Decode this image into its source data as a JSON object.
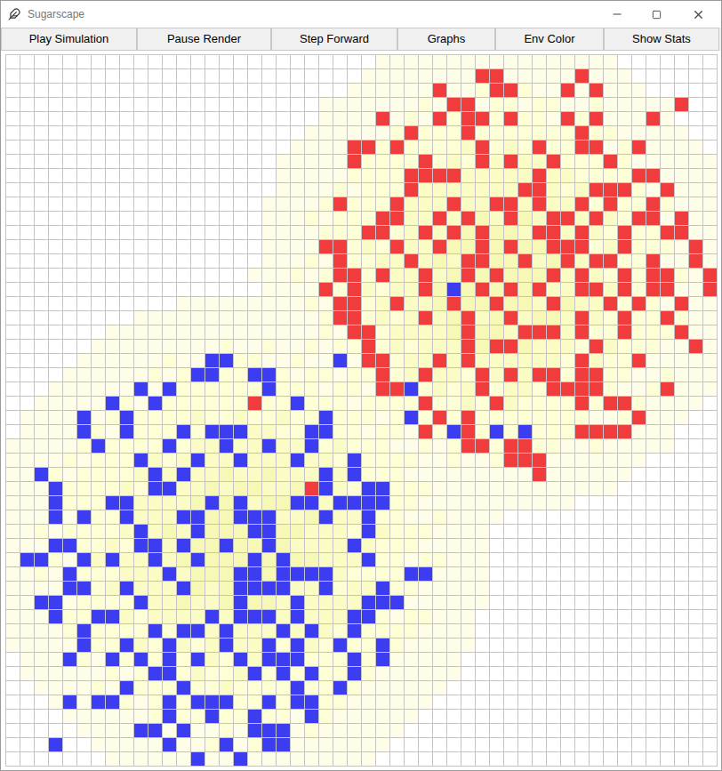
{
  "window": {
    "title": "Sugarscape"
  },
  "toolbar": [
    {
      "label": "Play Simulation"
    },
    {
      "label": "Pause Render"
    },
    {
      "label": "Step Forward"
    },
    {
      "label": "Graphs"
    },
    {
      "label": "Env Color"
    },
    {
      "label": "Show Stats"
    }
  ],
  "grid": {
    "rows": 50,
    "cols": 50,
    "sugar_peaks": [
      {
        "row": 15,
        "col": 34,
        "radius": 17,
        "max_level": 4
      },
      {
        "row": 34,
        "col": 16,
        "radius": 17.5,
        "max_level": 4
      }
    ],
    "tribes": [
      {
        "name": "red",
        "color": "#f03c3c",
        "cells": [
          [
            1,
            [
              33,
              34,
              40
            ]
          ],
          [
            2,
            [
              30,
              34,
              35,
              39,
              41
            ]
          ],
          [
            3,
            [
              31,
              32,
              47
            ]
          ],
          [
            4,
            [
              26,
              30,
              32,
              33,
              35,
              39,
              41,
              45
            ]
          ],
          [
            5,
            [
              28,
              32,
              40
            ]
          ],
          [
            6,
            [
              24,
              25,
              27,
              33,
              37,
              40,
              41,
              44
            ]
          ],
          [
            7,
            [
              24,
              29,
              33,
              35,
              38,
              42
            ]
          ],
          [
            8,
            [
              28,
              29,
              30,
              31,
              37,
              44,
              45
            ]
          ],
          [
            9,
            [
              28,
              36,
              37,
              41,
              42,
              43,
              46
            ]
          ],
          [
            10,
            [
              23,
              27,
              31,
              34,
              35,
              37,
              40,
              42,
              45
            ]
          ],
          [
            11,
            [
              26,
              27,
              30,
              32,
              35,
              38,
              39,
              41,
              44,
              45,
              47
            ]
          ],
          [
            12,
            [
              25,
              26,
              29,
              31,
              33,
              37,
              38,
              40,
              43,
              46,
              47
            ]
          ],
          [
            13,
            [
              22,
              23,
              27,
              30,
              33,
              35,
              38,
              39,
              40,
              43,
              48
            ]
          ],
          [
            14,
            [
              23,
              28,
              32,
              33,
              36,
              39,
              41,
              42,
              45,
              48
            ]
          ],
          [
            15,
            [
              23,
              24,
              26,
              29,
              32,
              34,
              38,
              40,
              43,
              45,
              46,
              49
            ]
          ],
          [
            16,
            [
              22,
              24,
              29,
              33,
              35,
              37,
              40,
              41,
              43,
              45,
              46,
              49
            ]
          ],
          [
            17,
            [
              23,
              24,
              27,
              31,
              34,
              38,
              42,
              44,
              47
            ]
          ],
          [
            18,
            [
              23,
              24,
              29,
              32,
              35,
              40,
              43,
              46
            ]
          ],
          [
            19,
            [
              24,
              25,
              32,
              36,
              37,
              38,
              40,
              43,
              47
            ]
          ],
          [
            20,
            [
              25,
              32,
              34,
              35,
              41,
              48
            ]
          ],
          [
            21,
            [
              25,
              26,
              30,
              32,
              40,
              44
            ]
          ],
          [
            22,
            [
              26,
              29,
              33,
              35,
              37,
              38,
              40,
              41
            ]
          ],
          [
            23,
            [
              26,
              27,
              33,
              38,
              39,
              40,
              41,
              46
            ]
          ],
          [
            24,
            [
              17,
              29,
              34,
              40,
              42,
              43
            ]
          ],
          [
            25,
            [
              30,
              32,
              44
            ]
          ],
          [
            26,
            [
              29,
              32,
              40,
              41,
              42,
              43
            ]
          ],
          [
            27,
            [
              32,
              33,
              35,
              36
            ]
          ],
          [
            28,
            [
              35,
              36,
              37
            ]
          ],
          [
            29,
            [
              37
            ]
          ],
          [
            30,
            [
              21
            ]
          ]
        ]
      },
      {
        "name": "blue",
        "color": "#3c3cf0",
        "cells": [
          [
            16,
            [
              31
            ]
          ],
          [
            21,
            [
              14,
              15,
              23
            ]
          ],
          [
            22,
            [
              13,
              14,
              17,
              18
            ]
          ],
          [
            23,
            [
              9,
              11,
              18,
              28
            ]
          ],
          [
            24,
            [
              7,
              10,
              20
            ]
          ],
          [
            25,
            [
              5,
              8,
              22,
              28
            ]
          ],
          [
            26,
            [
              5,
              8,
              12,
              14,
              15,
              16,
              21,
              22,
              31,
              34,
              36
            ]
          ],
          [
            27,
            [
              6,
              11,
              15,
              18,
              21
            ]
          ],
          [
            28,
            [
              9,
              13,
              16,
              20,
              24
            ]
          ],
          [
            29,
            [
              2,
              10,
              12,
              22,
              24
            ]
          ],
          [
            30,
            [
              3,
              10,
              11,
              22,
              25,
              26
            ]
          ],
          [
            31,
            [
              3,
              7,
              8,
              14,
              16,
              20,
              21,
              23,
              24,
              25,
              26
            ]
          ],
          [
            32,
            [
              3,
              5,
              8,
              12,
              13,
              16,
              17,
              18,
              22,
              25
            ]
          ],
          [
            33,
            [
              9,
              13,
              17,
              18,
              25
            ]
          ],
          [
            34,
            [
              3,
              4,
              9,
              10,
              12,
              15,
              18,
              24
            ]
          ],
          [
            35,
            [
              1,
              2,
              5,
              7,
              10,
              13,
              17,
              19,
              25
            ]
          ],
          [
            36,
            [
              4,
              11,
              16,
              17,
              19,
              20,
              21,
              22,
              28,
              29
            ]
          ],
          [
            37,
            [
              4,
              5,
              8,
              12,
              16,
              17,
              18,
              19,
              22,
              26
            ]
          ],
          [
            38,
            [
              2,
              3,
              9,
              16,
              20,
              25,
              26,
              27
            ]
          ],
          [
            39,
            [
              3,
              6,
              7,
              14,
              16,
              17,
              18,
              20,
              24,
              25
            ]
          ],
          [
            40,
            [
              5,
              10,
              12,
              13,
              15,
              19,
              21,
              24
            ]
          ],
          [
            41,
            [
              5,
              8,
              11,
              15,
              18,
              20,
              23,
              26
            ]
          ],
          [
            42,
            [
              4,
              7,
              9,
              11,
              13,
              16,
              18,
              19,
              20,
              24,
              26
            ]
          ],
          [
            43,
            [
              10,
              11,
              17,
              19,
              21,
              24
            ]
          ],
          [
            44,
            [
              8,
              12,
              20,
              23
            ]
          ],
          [
            45,
            [
              4,
              6,
              7,
              11,
              13,
              14,
              15,
              18,
              20,
              21
            ]
          ],
          [
            46,
            [
              11,
              14,
              17,
              21
            ]
          ],
          [
            47,
            [
              9,
              10,
              12,
              17,
              18,
              19
            ]
          ],
          [
            48,
            [
              3,
              11,
              15,
              18,
              19
            ]
          ],
          [
            49,
            [
              13,
              16
            ]
          ]
        ]
      }
    ]
  }
}
